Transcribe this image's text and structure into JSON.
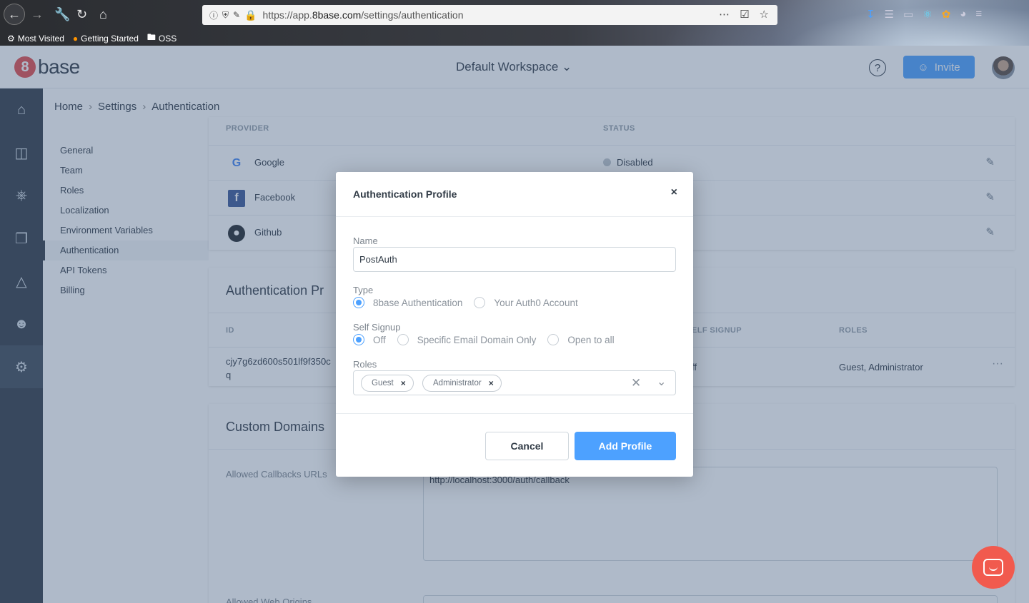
{
  "browser": {
    "url_prefix": "https://app.",
    "url_host": "8base.com",
    "url_path": "/settings/authentication",
    "bookmarks": [
      "Most Visited",
      "Getting Started",
      "OSS"
    ]
  },
  "header": {
    "workspace": "Default Workspace",
    "help": "?",
    "invite_label": "Invite"
  },
  "breadcrumb": [
    "Home",
    "Settings",
    "Authentication"
  ],
  "settings_nav": [
    {
      "label": "General"
    },
    {
      "label": "Team"
    },
    {
      "label": "Roles"
    },
    {
      "label": "Localization"
    },
    {
      "label": "Environment Variables"
    },
    {
      "label": "Authentication",
      "active": true
    },
    {
      "label": "API Tokens"
    },
    {
      "label": "Billing"
    }
  ],
  "providers": {
    "col_provider": "PROVIDER",
    "col_status": "STATUS",
    "rows": [
      {
        "name": "Google",
        "status": "Disabled"
      },
      {
        "name": "Facebook",
        "status": ""
      },
      {
        "name": "Github",
        "status": ""
      }
    ]
  },
  "auth_profiles": {
    "title": "Authentication Pr",
    "col_id": "ID",
    "col_self_signup": "ELF SIGNUP",
    "col_roles": "ROLES",
    "row": {
      "id_line1": "cjy7g6zd600s501lf9f350c",
      "id_line2": "q",
      "self_signup": "ff",
      "roles": "Guest, Administrator",
      "menu": "···"
    }
  },
  "custom_domains": {
    "title": "Custom Domains",
    "callbacks_label": "Allowed Callbacks URLs",
    "callbacks_value": "http://localhost:3000/auth/callback",
    "web_origins_label": "Allowed Web Origins"
  },
  "modal": {
    "title": "Authentication Profile",
    "close": "×",
    "name_label": "Name",
    "name_value": "PostAuth",
    "type_label": "Type",
    "type_options": [
      "8base Authentication",
      "Your Auth0 Account"
    ],
    "type_selected": "8base Authentication",
    "signup_label": "Self Signup",
    "signup_options": [
      "Off",
      "Specific Email Domain Only",
      "Open to all"
    ],
    "signup_selected": "Off",
    "roles_label": "Roles",
    "roles_selected": [
      "Guest",
      "Administrator"
    ],
    "tag_remove": "×",
    "clear_icon": "✕",
    "caret_icon": "⌄",
    "cancel_label": "Cancel",
    "submit_label": "Add Profile"
  },
  "colors": {
    "accent": "#4da1ff",
    "sidebar": "#323c47",
    "brand_red": "#e34c4c",
    "chat": "#f15a4e"
  }
}
